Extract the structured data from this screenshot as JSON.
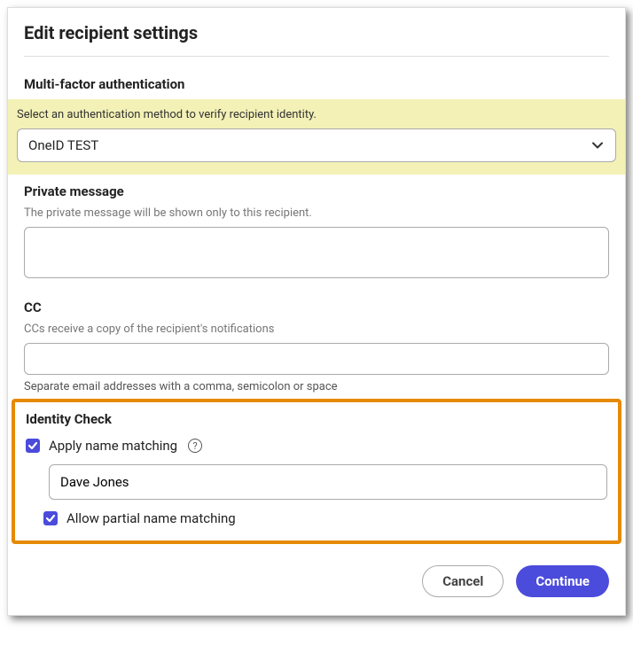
{
  "dialog": {
    "title": "Edit recipient settings"
  },
  "mfa": {
    "heading": "Multi-factor authentication",
    "helper": "Select an authentication method to verify recipient identity.",
    "selected": "OneID TEST"
  },
  "privateMessage": {
    "heading": "Private message",
    "helper": "The private message will be shown only to this recipient.",
    "value": ""
  },
  "cc": {
    "heading": "CC",
    "helper": "CCs receive a copy of the recipient's notifications",
    "value": "",
    "hint": "Separate email addresses with a comma, semicolon or space"
  },
  "identity": {
    "heading": "Identity Check",
    "applyNameMatching": {
      "label": "Apply name matching",
      "checked": true
    },
    "nameValue": "Dave Jones",
    "allowPartial": {
      "label": "Allow partial name matching",
      "checked": true
    }
  },
  "footer": {
    "cancel": "Cancel",
    "continue": "Continue"
  }
}
